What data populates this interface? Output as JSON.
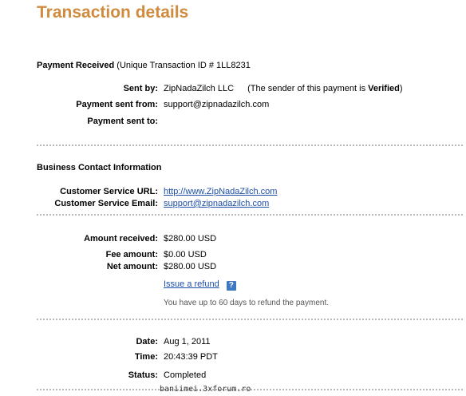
{
  "page": {
    "title": "Transaction details"
  },
  "payment": {
    "received_label": "Payment Received",
    "transaction_id_text": "(Unique Transaction ID # 1LL8231",
    "sent_by_label": "Sent by:",
    "sent_by_value": "ZipNadaZilch LLC",
    "sender_note_prefix": "(The sender of this payment is ",
    "sender_status": "Verified",
    "sender_note_suffix": ")",
    "sent_from_label": "Payment sent from:",
    "sent_from_value": "support@zipnadazilch.com",
    "sent_to_label": "Payment sent to:",
    "sent_to_value": ""
  },
  "business": {
    "heading": "Business Contact Information",
    "url_label": "Customer Service URL:",
    "url_value": "http://www.ZipNadaZilch.com",
    "email_label": "Customer Service Email:",
    "email_value": "support@zipnadazilch.com"
  },
  "amounts": {
    "received_label": "Amount received:",
    "received_value": "$280.00 USD",
    "fee_label": "Fee amount:",
    "fee_value": "$0.00 USD",
    "net_label": "Net amount:",
    "net_value": "$280.00 USD",
    "refund_link": "Issue a refund",
    "help_icon_glyph": "?",
    "refund_note": "You have up to 60 days to refund the payment."
  },
  "details": {
    "date_label": "Date:",
    "date_value": "Aug 1, 2011",
    "time_label": "Time:",
    "time_value": "20:43:39 PDT",
    "status_label": "Status:",
    "status_value": "Completed"
  },
  "watermark": "baniimei.3xforum.ro",
  "colors": {
    "title": "#d08b3e",
    "link": "#1f4ea8",
    "help_icon": "#3e77c2"
  }
}
